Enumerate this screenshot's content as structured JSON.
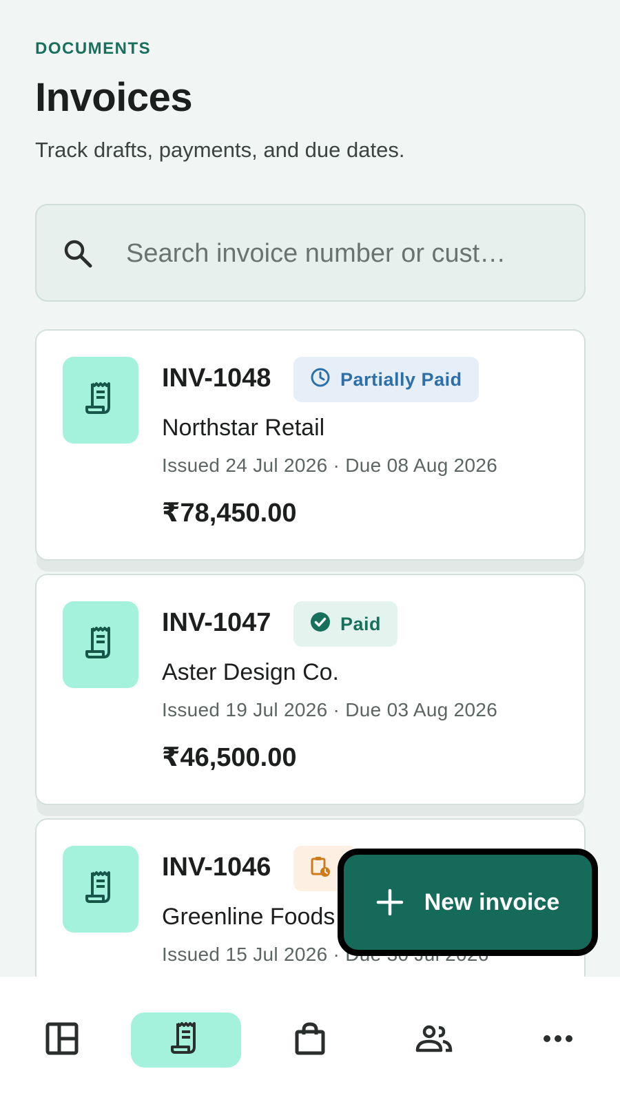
{
  "header": {
    "eyebrow": "DOCUMENTS",
    "title": "Invoices",
    "subtitle": "Track drafts, payments, and due dates."
  },
  "search": {
    "placeholder": "Search invoice number or cust…",
    "icon": "search-icon"
  },
  "invoices": [
    {
      "number": "INV-1048",
      "status": "Partially Paid",
      "status_icon": "clock-icon",
      "status_color": "#2d6fa6",
      "customer": "Northstar Retail",
      "dates": "Issued 24 Jul 2026 · Due 08 Aug 2026",
      "amount": "₹78,450.00"
    },
    {
      "number": "INV-1047",
      "status": "Paid",
      "status_icon": "check-circle-icon",
      "status_color": "#17705c",
      "customer": "Aster Design Co.",
      "dates": "Issued 19 Jul 2026 · Due 03 Aug 2026",
      "amount": "₹46,500.00"
    },
    {
      "number": "INV-1046",
      "status": "",
      "status_icon": "clipboard-clock-icon",
      "status_color": "#cf7a1a",
      "customer": "Greenline Foods",
      "dates": "Issued 15 Jul 2026 · Due 30 Jul 2026",
      "amount": ""
    }
  ],
  "fab": {
    "label": "New invoice",
    "icon": "plus-icon"
  },
  "bottom_nav": {
    "items": [
      {
        "icon": "dashboard-icon",
        "active": false
      },
      {
        "icon": "receipt-icon",
        "active": true
      },
      {
        "icon": "shopping-bag-icon",
        "active": false
      },
      {
        "icon": "people-icon",
        "active": false
      },
      {
        "icon": "more-horizontal-icon",
        "active": false
      }
    ]
  },
  "colors": {
    "accent": "#166a59",
    "accent_light": "#a5f2dc",
    "background": "#f1f5f4"
  }
}
